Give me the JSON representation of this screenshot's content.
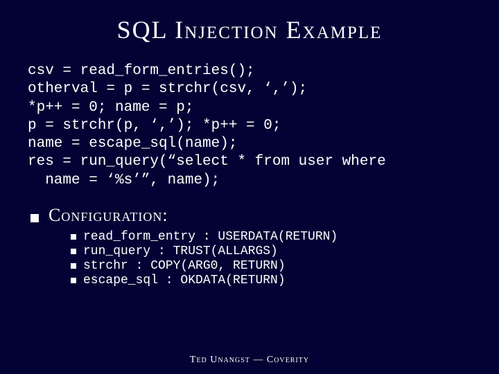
{
  "title": "SQL Injection Example",
  "code_lines": [
    "csv = read_form_entries();",
    "otherval = p = strchr(csv, ‘,’);",
    "*p++ = 0; name = p;",
    "p = strchr(p, ‘,’); *p++ = 0;",
    "name = escape_sql(name);",
    "res = run_query(“select * from user where",
    "  name = ‘%s’”, name);"
  ],
  "section_label": "Configuration:",
  "config_items": [
    "read_form_entry : USERDATA(RETURN)",
    "run_query : TRUST(ALLARGS)",
    "strchr : COPY(ARG0, RETURN)",
    "escape_sql : OKDATA(RETURN)"
  ],
  "footer": "Ted Unangst — Coverity"
}
